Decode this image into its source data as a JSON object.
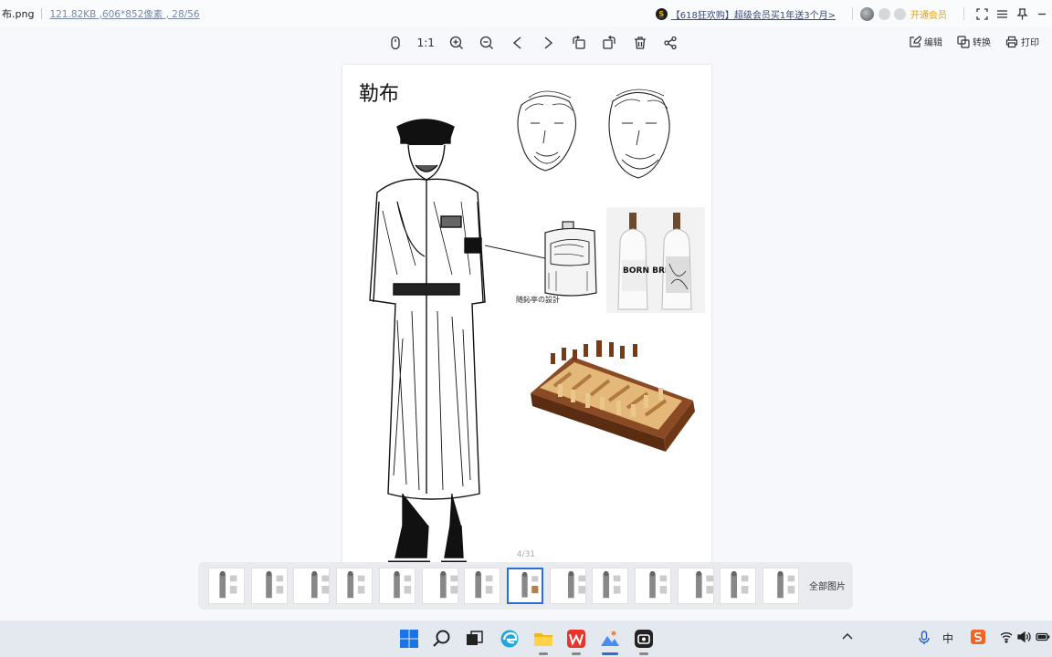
{
  "window": {
    "file_name": "布.png",
    "file_meta": "121.82KB ,606*852像素 , 28/56",
    "promo_text": "【618狂欢购】超级会员买1年送3个月>",
    "vip_label": "开通会员"
  },
  "toolbar": {
    "ratio_label": "1:1",
    "edit_label": "编辑",
    "convert_label": "转换",
    "print_label": "打印"
  },
  "image": {
    "title": "勒布",
    "signature": "随鈊亭の設計",
    "bottle_label": "BORN BRED"
  },
  "thumbnails": {
    "counter": "4/31",
    "all_label": "全部图片",
    "count": 14,
    "active_index": 7
  },
  "taskbar": {
    "ime_label": "中"
  },
  "colors": {
    "accent": "#2a6fd8",
    "vip": "#e8a000",
    "page_bg": "#f7f8fb"
  }
}
